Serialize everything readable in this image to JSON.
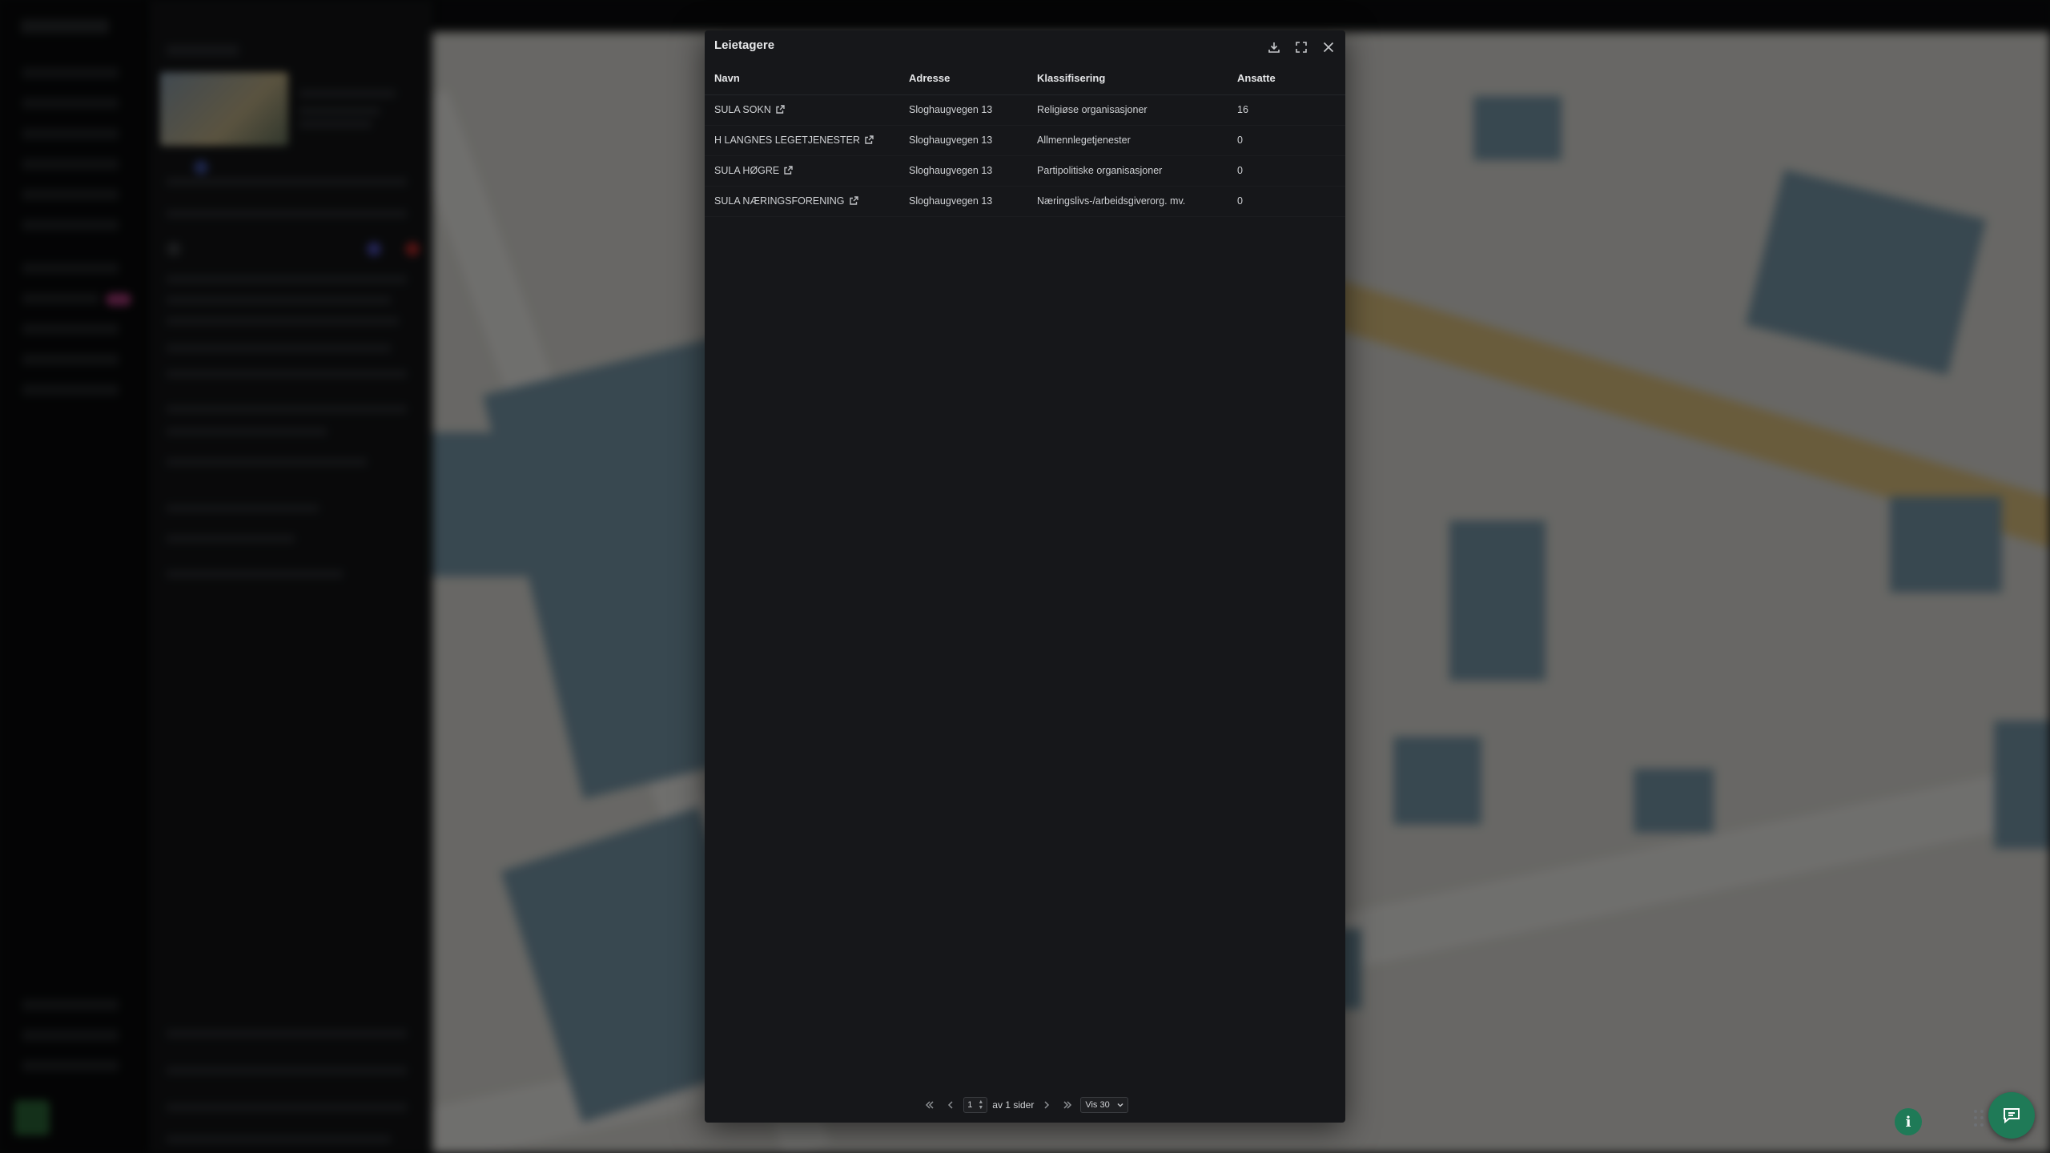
{
  "modal": {
    "title": "Leietagere",
    "actions": {
      "download_icon": "download-icon",
      "expand_icon": "expand-icon",
      "close_icon": "close-icon"
    },
    "columns": {
      "name": "Navn",
      "address": "Adresse",
      "classification": "Klassifisering",
      "employees": "Ansatte"
    },
    "rows": [
      {
        "name": "SULA SOKN",
        "address": "Sloghaugvegen 13",
        "classification": "Religiøse organisasjoner",
        "employees": "16"
      },
      {
        "name": "H LANGNES LEGETJENESTER",
        "address": "Sloghaugvegen 13",
        "classification": "Allmennlegetjenester",
        "employees": "0"
      },
      {
        "name": "SULA HØGRE",
        "address": "Sloghaugvegen 13",
        "classification": "Partipolitiske organisasjoner",
        "employees": "0"
      },
      {
        "name": "SULA NÆRINGSFORENING",
        "address": "Sloghaugvegen 13",
        "classification": "Næringslivs-/arbeidsgiverorg. mv.",
        "employees": "0"
      }
    ],
    "pagination": {
      "current_page": "1",
      "of_pages": "av 1 sider",
      "page_size": "Vis 30"
    }
  },
  "floating": {
    "info_label": "i",
    "chat_icon": "chat-icon"
  },
  "colors": {
    "accent": "#1f7a57",
    "modal_bg": "#16171a",
    "map_building": "#7d9fb1",
    "map_road": "#e9cc86"
  }
}
